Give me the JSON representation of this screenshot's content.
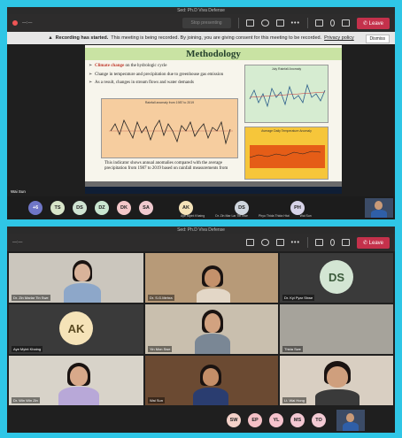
{
  "window_title": "Sed: Ph.D Viva Defense",
  "toolbar": {
    "stop_button": "Stop presenting",
    "leave_button": "Leave",
    "more": "•••"
  },
  "banner": {
    "bold": "Recording has started.",
    "text": "This meeting is being recorded. By joining, you are giving consent for this meeting to be recorded.",
    "link": "Privacy policy",
    "dismiss": "Dismiss"
  },
  "slide": {
    "title": "Methodology",
    "bullet1_kw": "Climate change",
    "bullet1_rest": "on the hydrologic cycle",
    "bullet2": "Change in temperature and precipitation due to greenhouse gas emission",
    "bullet3": "As a result, changes in stream flows and water demands",
    "caption": "This indicator shows annual anomalies compared with the average precipitation from 1987 to 2019 based on rainfall measurements from",
    "chart1_title": "Rainfall anomaly from 1987 to 2019",
    "chart2_title": "July Rainfall Anomaly",
    "chart3_title": "Average Daily Temperature Anomaly"
  },
  "share_presenter": "Wai Sun",
  "top_strip": {
    "overflow": "+6",
    "avatars": [
      {
        "initials": "TS",
        "color": "#d8e5c9"
      },
      {
        "initials": "DS",
        "color": "#cfe3d2"
      },
      {
        "initials": "DZ",
        "color": "#c9e6d0"
      },
      {
        "initials": "DK",
        "color": "#f3c7c9"
      },
      {
        "initials": "SA",
        "color": "#f0c9cf"
      },
      {
        "initials": "AK",
        "color": "#f4e2b8"
      },
      {
        "initials": "DS",
        "color": "#cfd6de"
      },
      {
        "initials": "PH",
        "color": "#d7d3e8"
      }
    ],
    "names": [
      "Aye Myint Khaing",
      "Dr. Zin Mar Lar Tin Swe",
      "Phyu Thida Thida Htut",
      "Wai Sun"
    ]
  },
  "gallery": {
    "tiles": [
      {
        "name": "Dr. Zin Marlar Tin Swe"
      },
      {
        "name": "Dr. S.G.Mehra"
      },
      {
        "name": "Dr. Kyi Pyar Shwe",
        "initials": "DS",
        "color": "#d3e5d3"
      },
      {
        "name": "Aye Myint Khaing",
        "initials": "AK",
        "color": "#f5e3b8"
      },
      {
        "name": "Yin Mon Swe"
      },
      {
        "name": "Thida Swe"
      },
      {
        "name": "Dr. Win Win Zin"
      },
      {
        "name": "Wai Sun"
      },
      {
        "name": "Lt. Wai Hong"
      }
    ]
  },
  "bottom_strip": [
    {
      "initials": "SW",
      "color": "#f4d1c9"
    },
    {
      "initials": "EP",
      "color": "#f4c0c6"
    },
    {
      "initials": "YL",
      "color": "#f6c3cd"
    },
    {
      "initials": "MS",
      "color": "#f2c7d2"
    },
    {
      "initials": "TO",
      "color": "#f2cad4"
    }
  ],
  "colors": {
    "leave": "#c4314b",
    "outer": "#2fc6e6"
  }
}
